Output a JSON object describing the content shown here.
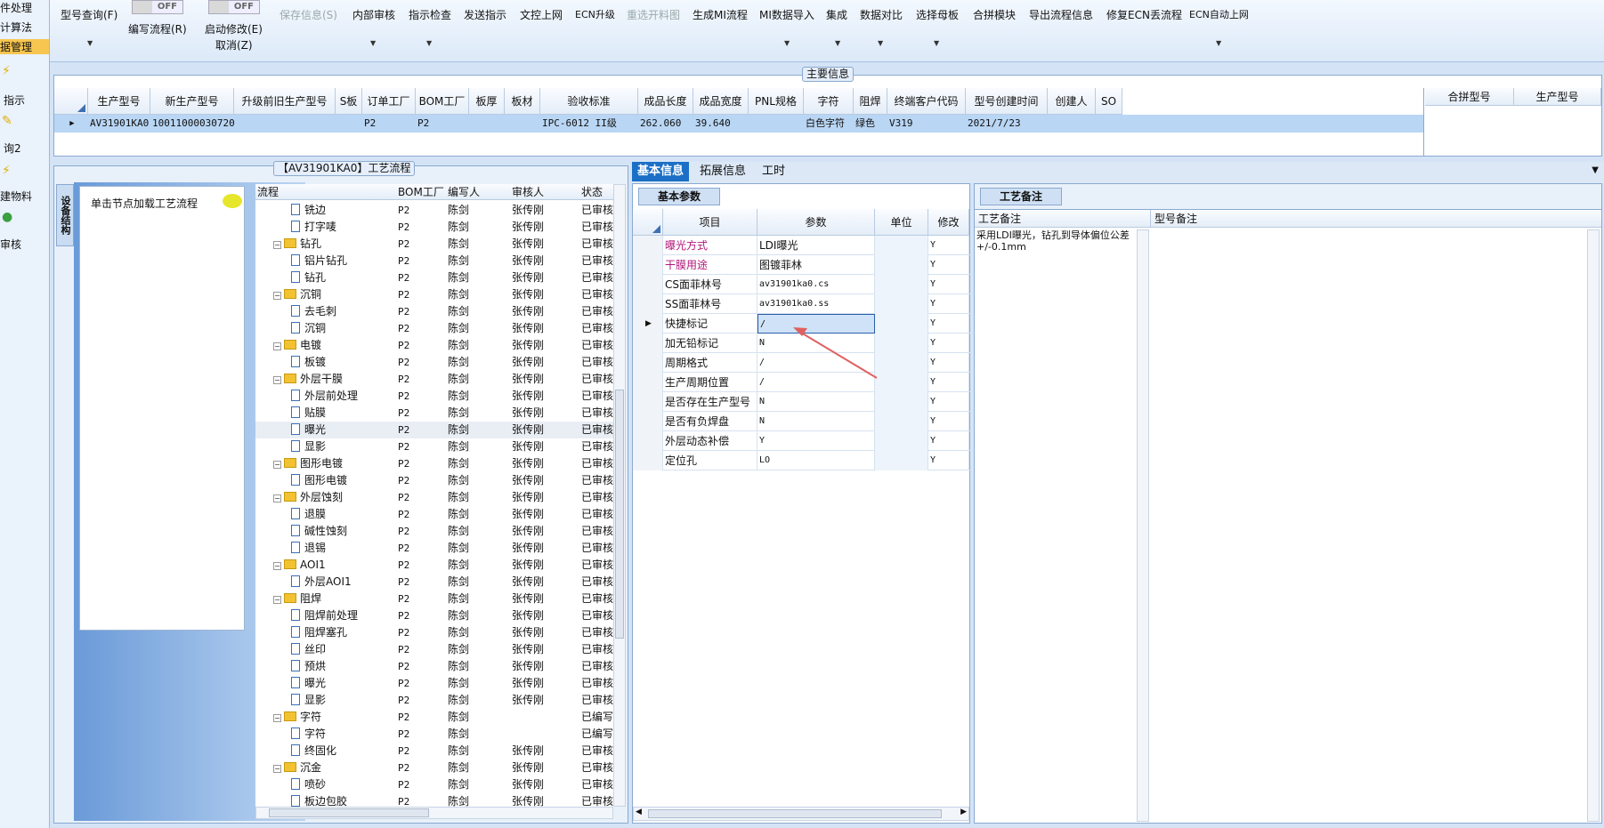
{
  "left_nav": {
    "items": [
      {
        "label": "件处理"
      },
      {
        "label": "计算法"
      },
      {
        "label": "据管理"
      },
      {
        "label": "指示"
      },
      {
        "label": "询2"
      },
      {
        "label": "建物料"
      },
      {
        "label": "审核"
      }
    ]
  },
  "toolbar": {
    "model_query": "型号查询(F)",
    "toggle1_state": "OFF",
    "write_flow": "编写流程(R)",
    "toggle2_state": "OFF",
    "start_modify": "启动修改(E)",
    "cancel": "取消(Z)",
    "save_info": "保存信息(S)",
    "internal_review": "内部审核",
    "indicator_check": "指示检查",
    "send_indicator": "发送指示",
    "upload_doc": "文控上网",
    "ecn_upgrade": "ECN升级",
    "reselect_drawing": "重选开料图",
    "gen_mi_flow": "生成MI流程",
    "mi_import": "MI数据导入",
    "integrate": "集成",
    "data_compare": "数据对比",
    "select_master": "选择母板",
    "merge_module": "合拼模块",
    "export_flow": "导出流程信息",
    "fix_ecn_flow": "修复ECN丢流程",
    "ecn_auto_upload": "ECN自动上网"
  },
  "main_info": {
    "title": "主要信息",
    "headers": [
      "生产型号",
      "新生产型号",
      "升级前旧生产型号",
      "S板",
      "订单工厂",
      "BOM工厂",
      "板厚",
      "板材",
      "验收标准",
      "成品长度",
      "成品宽度",
      "PNL规格",
      "字符",
      "阻焊",
      "终端客户代码",
      "型号创建时间",
      "创建人",
      "SO"
    ],
    "row": [
      "AV31901KA0",
      "10011000030720",
      "",
      "",
      "P2",
      "P2",
      "",
      "",
      "IPC-6012 II级",
      "262.060",
      "39.640",
      "",
      "白色字符",
      "绿色",
      "V319",
      "2021/7/23",
      "",
      ""
    ],
    "merge_headers": [
      "合拼型号",
      "生产型号"
    ]
  },
  "flow_panel": {
    "title": "【AV31901KA0】工艺流程",
    "side_tab": "设备结构",
    "load_hint": "单击节点加载工艺流程",
    "columns": [
      "流程",
      "BOM工厂",
      "编写人",
      "审核人",
      "状态"
    ],
    "rows": [
      {
        "name": "铣边",
        "type": "doc",
        "level": 1,
        "bom": "P2",
        "writer": "陈剑",
        "reviewer": "张传刚",
        "status": "已审核"
      },
      {
        "name": "打字唛",
        "type": "doc",
        "level": 1,
        "bom": "P2",
        "writer": "陈剑",
        "reviewer": "张传刚",
        "status": "已审核"
      },
      {
        "name": "钻孔",
        "type": "folder",
        "level": 0,
        "bom": "P2",
        "writer": "陈剑",
        "reviewer": "张传刚",
        "status": "已审核"
      },
      {
        "name": "铝片钻孔",
        "type": "doc",
        "level": 1,
        "bom": "P2",
        "writer": "陈剑",
        "reviewer": "张传刚",
        "status": "已审核"
      },
      {
        "name": "钻孔",
        "type": "doc",
        "level": 1,
        "bom": "P2",
        "writer": "陈剑",
        "reviewer": "张传刚",
        "status": "已审核"
      },
      {
        "name": "沉铜",
        "type": "folder",
        "level": 0,
        "bom": "P2",
        "writer": "陈剑",
        "reviewer": "张传刚",
        "status": "已审核"
      },
      {
        "name": "去毛刺",
        "type": "doc",
        "level": 1,
        "bom": "P2",
        "writer": "陈剑",
        "reviewer": "张传刚",
        "status": "已审核"
      },
      {
        "name": "沉铜",
        "type": "doc",
        "level": 1,
        "bom": "P2",
        "writer": "陈剑",
        "reviewer": "张传刚",
        "status": "已审核"
      },
      {
        "name": "电镀",
        "type": "folder",
        "level": 0,
        "bom": "P2",
        "writer": "陈剑",
        "reviewer": "张传刚",
        "status": "已审核"
      },
      {
        "name": "板镀",
        "type": "doc",
        "level": 1,
        "bom": "P2",
        "writer": "陈剑",
        "reviewer": "张传刚",
        "status": "已审核"
      },
      {
        "name": "外层干膜",
        "type": "folder",
        "level": 0,
        "bom": "P2",
        "writer": "陈剑",
        "reviewer": "张传刚",
        "status": "已审核"
      },
      {
        "name": "外层前处理",
        "type": "doc",
        "level": 1,
        "bom": "P2",
        "writer": "陈剑",
        "reviewer": "张传刚",
        "status": "已审核"
      },
      {
        "name": "贴膜",
        "type": "doc",
        "level": 1,
        "bom": "P2",
        "writer": "陈剑",
        "reviewer": "张传刚",
        "status": "已审核"
      },
      {
        "name": "曝光",
        "type": "doc",
        "level": 1,
        "bom": "P2",
        "writer": "陈剑",
        "reviewer": "张传刚",
        "status": "已审核"
      },
      {
        "name": "显影",
        "type": "doc",
        "level": 1,
        "bom": "P2",
        "writer": "陈剑",
        "reviewer": "张传刚",
        "status": "已审核"
      },
      {
        "name": "图形电镀",
        "type": "folder",
        "level": 0,
        "bom": "P2",
        "writer": "陈剑",
        "reviewer": "张传刚",
        "status": "已审核"
      },
      {
        "name": "图形电镀",
        "type": "doc",
        "level": 1,
        "bom": "P2",
        "writer": "陈剑",
        "reviewer": "张传刚",
        "status": "已审核"
      },
      {
        "name": "外层蚀刻",
        "type": "folder",
        "level": 0,
        "bom": "P2",
        "writer": "陈剑",
        "reviewer": "张传刚",
        "status": "已审核"
      },
      {
        "name": "退膜",
        "type": "doc",
        "level": 1,
        "bom": "P2",
        "writer": "陈剑",
        "reviewer": "张传刚",
        "status": "已审核"
      },
      {
        "name": "碱性蚀刻",
        "type": "doc",
        "level": 1,
        "bom": "P2",
        "writer": "陈剑",
        "reviewer": "张传刚",
        "status": "已审核"
      },
      {
        "name": "退锡",
        "type": "doc",
        "level": 1,
        "bom": "P2",
        "writer": "陈剑",
        "reviewer": "张传刚",
        "status": "已审核"
      },
      {
        "name": "AOI1",
        "type": "folder",
        "level": 0,
        "bom": "P2",
        "writer": "陈剑",
        "reviewer": "张传刚",
        "status": "已审核"
      },
      {
        "name": "外层AOI1",
        "type": "doc",
        "level": 1,
        "bom": "P2",
        "writer": "陈剑",
        "reviewer": "张传刚",
        "status": "已审核"
      },
      {
        "name": "阻焊",
        "type": "folder",
        "level": 0,
        "bom": "P2",
        "writer": "陈剑",
        "reviewer": "张传刚",
        "status": "已审核"
      },
      {
        "name": "阻焊前处理",
        "type": "doc",
        "level": 1,
        "bom": "P2",
        "writer": "陈剑",
        "reviewer": "张传刚",
        "status": "已审核"
      },
      {
        "name": "阻焊塞孔",
        "type": "doc",
        "level": 1,
        "bom": "P2",
        "writer": "陈剑",
        "reviewer": "张传刚",
        "status": "已审核"
      },
      {
        "name": "丝印",
        "type": "doc",
        "level": 1,
        "bom": "P2",
        "writer": "陈剑",
        "reviewer": "张传刚",
        "status": "已审核"
      },
      {
        "name": "预烘",
        "type": "doc",
        "level": 1,
        "bom": "P2",
        "writer": "陈剑",
        "reviewer": "张传刚",
        "status": "已审核"
      },
      {
        "name": "曝光",
        "type": "doc",
        "level": 1,
        "bom": "P2",
        "writer": "陈剑",
        "reviewer": "张传刚",
        "status": "已审核"
      },
      {
        "name": "显影",
        "type": "doc",
        "level": 1,
        "bom": "P2",
        "writer": "陈剑",
        "reviewer": "张传刚",
        "status": "已审核"
      },
      {
        "name": "字符",
        "type": "folder",
        "level": 0,
        "bom": "P2",
        "writer": "陈剑",
        "reviewer": "",
        "status": "已编写"
      },
      {
        "name": "字符",
        "type": "doc",
        "level": 1,
        "bom": "P2",
        "writer": "陈剑",
        "reviewer": "",
        "status": "已编写"
      },
      {
        "name": "终固化",
        "type": "doc",
        "level": 1,
        "bom": "P2",
        "writer": "陈剑",
        "reviewer": "张传刚",
        "status": "已审核"
      },
      {
        "name": "沉金",
        "type": "folder",
        "level": 0,
        "bom": "P2",
        "writer": "陈剑",
        "reviewer": "张传刚",
        "status": "已审核"
      },
      {
        "name": "喷砂",
        "type": "doc",
        "level": 1,
        "bom": "P2",
        "writer": "陈剑",
        "reviewer": "张传刚",
        "status": "已审核"
      },
      {
        "name": "板边包胶",
        "type": "doc",
        "level": 1,
        "bom": "P2",
        "writer": "陈剑",
        "reviewer": "张传刚",
        "status": "已审核"
      }
    ]
  },
  "tabs": [
    "基本信息",
    "拓展信息",
    "工时"
  ],
  "params": {
    "subtab": "基本参数",
    "columns": [
      "项目",
      "参数",
      "单位",
      "修改"
    ],
    "rows": [
      {
        "item": "曝光方式",
        "value": "LDI曝光",
        "unit": "",
        "mod": "Y",
        "highlight": true
      },
      {
        "item": "干膜用途",
        "value": "图镀菲林",
        "unit": "",
        "mod": "Y",
        "highlight": true
      },
      {
        "item": "CS面菲林号",
        "value": "av31901ka0.cs",
        "unit": "",
        "mod": "Y",
        "highlight": false
      },
      {
        "item": "SS面菲林号",
        "value": "av31901ka0.ss",
        "unit": "",
        "mod": "Y",
        "highlight": false
      },
      {
        "item": "快捷标记",
        "value": "/",
        "unit": "",
        "mod": "Y",
        "highlight": false
      },
      {
        "item": "加无铅标记",
        "value": "N",
        "unit": "",
        "mod": "Y",
        "highlight": false
      },
      {
        "item": "周期格式",
        "value": "/",
        "unit": "",
        "mod": "Y",
        "highlight": false
      },
      {
        "item": "生产周期位置",
        "value": "/",
        "unit": "",
        "mod": "Y",
        "highlight": false
      },
      {
        "item": "是否存在生产型号",
        "value": "N",
        "unit": "",
        "mod": "Y",
        "highlight": false
      },
      {
        "item": "是否有负焊盘",
        "value": "N",
        "unit": "",
        "mod": "Y",
        "highlight": false
      },
      {
        "item": "外层动态补偿",
        "value": "Y",
        "unit": "",
        "mod": "Y",
        "highlight": false
      },
      {
        "item": "定位孔",
        "value": "LO",
        "unit": "",
        "mod": "Y",
        "highlight": false
      }
    ]
  },
  "remarks": {
    "tab": "工艺备注",
    "col1": "工艺备注",
    "col2": "型号备注",
    "text": "采用LDI曝光，钻孔到导体偏位公差+/-0.1mm"
  },
  "colors": {
    "accent": "#1b6fc6",
    "highlight_text": "#b0187a",
    "arrow": "#e06060"
  }
}
